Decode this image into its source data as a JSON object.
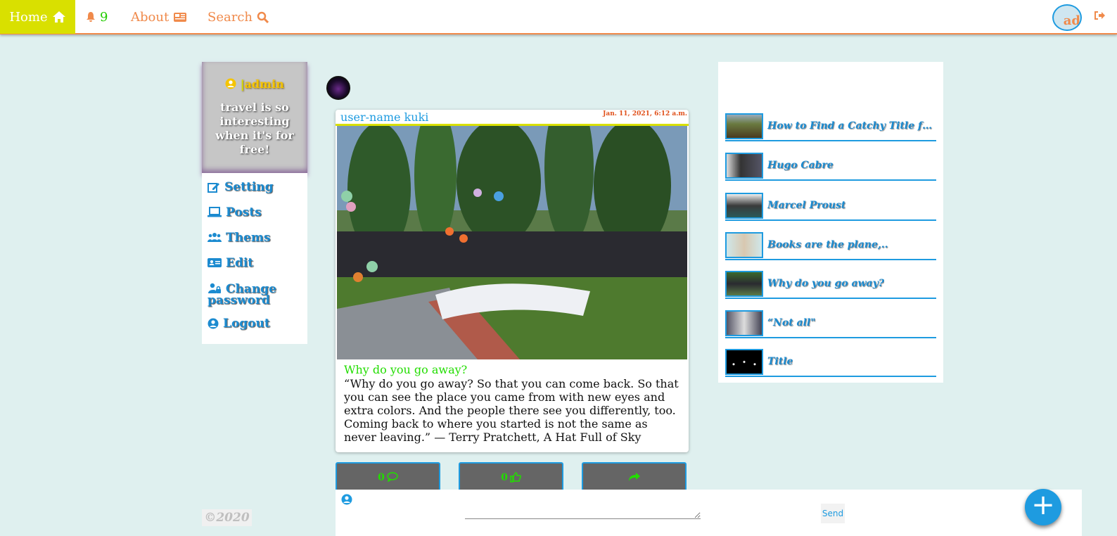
{
  "nav": {
    "home_label": "Home",
    "notifications_count": "9",
    "about_label": "About",
    "search_label": "Search",
    "avatar_initials": "ad"
  },
  "profile": {
    "username": "admin",
    "bio": "travel is so interesting when it's for free!"
  },
  "sidebar": {
    "items": [
      {
        "label": "Setting",
        "icon": "edit-icon"
      },
      {
        "label": "Posts",
        "icon": "laptop-icon"
      },
      {
        "label": "Thems",
        "icon": "users-icon"
      },
      {
        "label": "Edit",
        "icon": "id-card-icon"
      },
      {
        "label": "Change password",
        "icon": "user-lock-icon"
      },
      {
        "label": "Logout",
        "icon": "user-circle-icon"
      }
    ]
  },
  "footer": {
    "copyright": "©2020"
  },
  "post": {
    "author": "user-name kuki",
    "date": "Jan. 11, 2021, 6:12 a.m.",
    "title": "Why do you go away?",
    "body": "“Why do you go away? So that you can come back. So that you can see the place you came from with new eyes and extra colors. And the people there see you differently, too. Coming back to where you started is not the same as never leaving.” — Terry Pratchett, A Hat Full of Sky",
    "comments_count": "0",
    "likes_count": "0"
  },
  "comment_box": {
    "send_label": "Send"
  },
  "right_panel": {
    "items": [
      {
        "title": "How to Find a Catchy Title for ..."
      },
      {
        "title": "Hugo Cabre"
      },
      {
        "title": "Marcel Proust"
      },
      {
        "title": "Books are the plane,.."
      },
      {
        "title": "Why do you go away?"
      },
      {
        "title": "“Not all\""
      },
      {
        "title": "Title"
      }
    ]
  },
  "colors": {
    "accent": "#f08a4b",
    "home_bg": "#d9e000",
    "link_blue": "#1e9be0",
    "page_bg": "#dff0ef"
  }
}
